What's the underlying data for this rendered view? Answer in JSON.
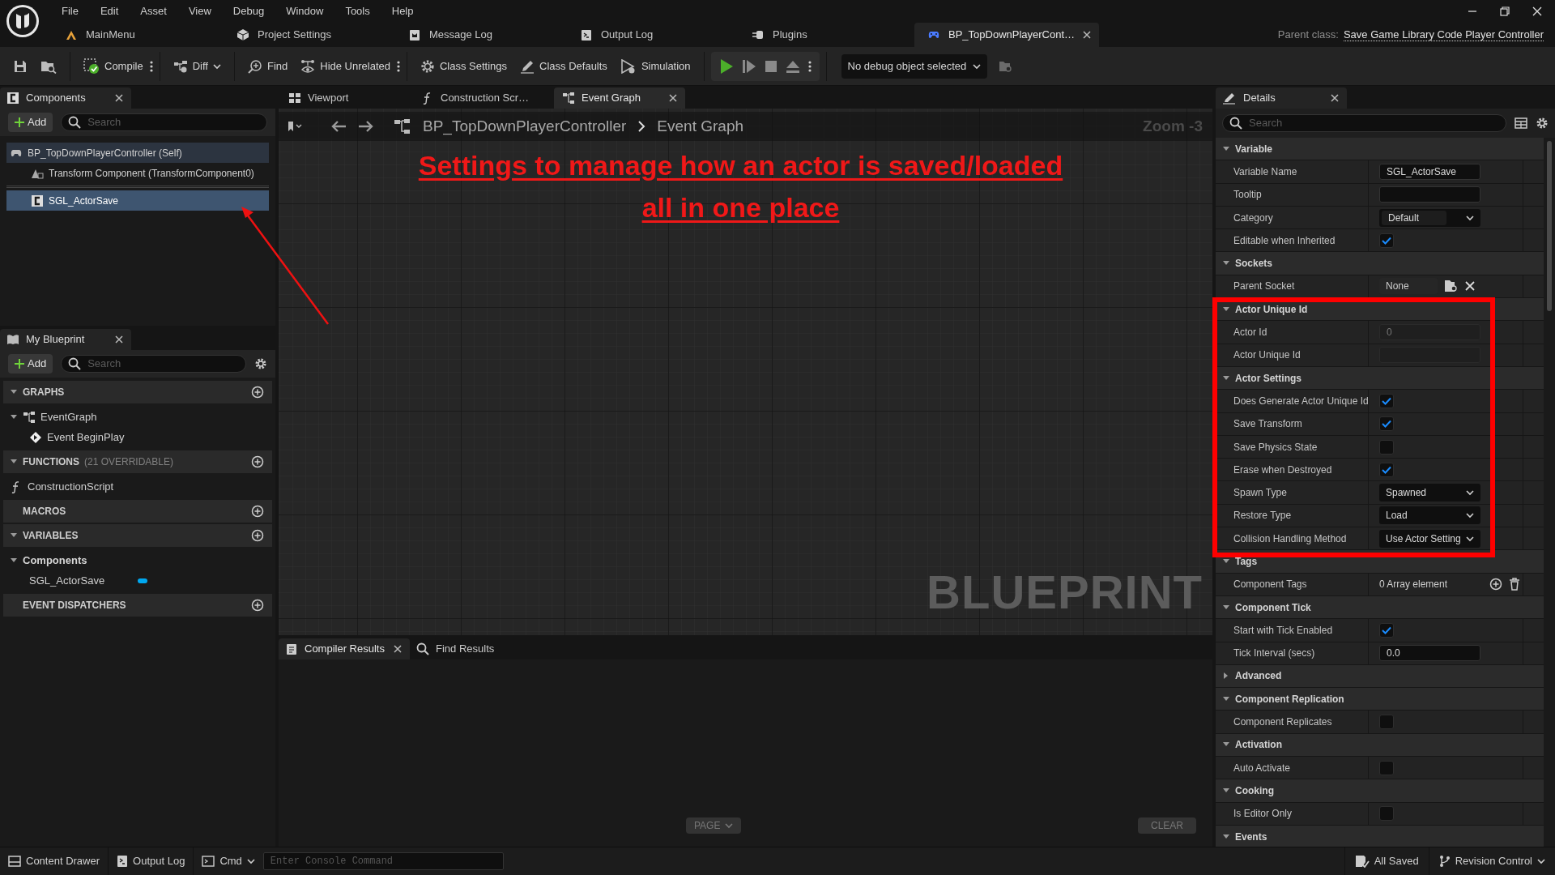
{
  "menu": [
    "File",
    "Edit",
    "Asset",
    "View",
    "Debug",
    "Window",
    "Tools",
    "Help"
  ],
  "asset_tabs": [
    {
      "label": "MainMenu",
      "selected": false
    },
    {
      "label": "Project Settings",
      "selected": false
    },
    {
      "label": "Message Log",
      "selected": false
    },
    {
      "label": "Output Log",
      "selected": false
    },
    {
      "label": "Plugins",
      "selected": false
    },
    {
      "label": "BP_TopDownPlayerCont…",
      "selected": true
    }
  ],
  "parent_class": {
    "label": "Parent class:",
    "value": "Save Game Library Code Player Controller"
  },
  "toolbar": {
    "compile": "Compile",
    "diff": "Diff",
    "find": "Find",
    "hide_unrelated": "Hide Unrelated",
    "class_settings": "Class Settings",
    "class_defaults": "Class Defaults",
    "simulation": "Simulation",
    "debug_object": "No debug object selected"
  },
  "components": {
    "title": "Components",
    "add": "Add",
    "search_placeholder": "Search",
    "items": [
      {
        "label": "BP_TopDownPlayerController (Self)",
        "selected": false,
        "children": [
          {
            "label": "Transform Component (TransformComponent0)",
            "kind": "native",
            "selected": false
          },
          {
            "label": "SGL_ActorSave",
            "kind": "added",
            "selected": true
          }
        ]
      }
    ]
  },
  "my_blueprint": {
    "title": "My Blueprint",
    "add": "Add",
    "search_placeholder": "Search",
    "sections": [
      {
        "title": "GRAPHS",
        "expanded": true,
        "items": [
          {
            "label": "EventGraph",
            "kind": "graph",
            "expanded": true,
            "children": [
              {
                "label": "Event BeginPlay",
                "kind": "event"
              }
            ]
          }
        ]
      },
      {
        "title": "FUNCTIONS",
        "note": "(21 OVERRIDABLE)",
        "expanded": true,
        "items": [
          {
            "label": "ConstructionScript",
            "kind": "function"
          }
        ]
      },
      {
        "title": "MACROS"
      },
      {
        "title": "VARIABLES",
        "expanded": true,
        "items": [
          {
            "label": "Components",
            "kind": "category",
            "expanded": true,
            "children": [
              {
                "label": "SGL_ActorSave",
                "kind": "variable",
                "color": "#00a8f0"
              }
            ]
          }
        ]
      },
      {
        "title": "EVENT DISPATCHERS"
      }
    ]
  },
  "graph": {
    "tabs": [
      {
        "label": "Viewport",
        "selected": false
      },
      {
        "label": "Construction Scr…",
        "selected": false
      },
      {
        "label": "Event Graph",
        "selected": true
      }
    ],
    "breadcrumb": [
      "BP_TopDownPlayerController",
      "Event Graph"
    ],
    "zoom": "Zoom -3",
    "watermark": "BLUEPRINT"
  },
  "annotation": {
    "lines": [
      "Settings to manage how an actor is saved/loaded",
      "all in one place"
    ]
  },
  "results": {
    "tabs": [
      {
        "label": "Compiler Results",
        "selected": true
      },
      {
        "label": "Find Results",
        "selected": false
      }
    ],
    "page": "PAGE",
    "clear": "CLEAR"
  },
  "details": {
    "title": "Details",
    "search_placeholder": "Search",
    "sections": [
      {
        "title": "Variable",
        "expanded": true,
        "rows": [
          {
            "label": "Variable Name",
            "kind": "text",
            "value": "SGL_ActorSave"
          },
          {
            "label": "Tooltip",
            "kind": "text"
          },
          {
            "label": "Category",
            "kind": "combo",
            "value": "Default"
          },
          {
            "label": "Editable when Inherited",
            "kind": "check",
            "checked": true
          }
        ]
      },
      {
        "title": "Sockets",
        "expanded": true,
        "rows": [
          {
            "label": "Parent Socket",
            "kind": "socket",
            "value": "None"
          }
        ]
      },
      {
        "title": "Actor Unique Id",
        "expanded": true,
        "rows": [
          {
            "label": "Actor Id",
            "kind": "text",
            "value": "0",
            "disabled": true
          },
          {
            "label": "Actor Unique Id",
            "kind": "text",
            "disabled": true
          }
        ]
      },
      {
        "title": "Actor Settings",
        "expanded": true,
        "rows": [
          {
            "label": "Does Generate Actor Unique Id",
            "kind": "check",
            "checked": true
          },
          {
            "label": "Save Transform",
            "kind": "check",
            "checked": true
          },
          {
            "label": "Save Physics State",
            "kind": "check",
            "checked": false
          },
          {
            "label": "Erase when Destroyed",
            "kind": "check",
            "checked": true
          },
          {
            "label": "Spawn Type",
            "kind": "dropdown",
            "value": "Spawned"
          },
          {
            "label": "Restore Type",
            "kind": "dropdown",
            "value": "Load"
          },
          {
            "label": "Collision Handling Method",
            "kind": "dropdown",
            "value": "Use Actor Setting"
          }
        ]
      },
      {
        "title": "Tags",
        "expanded": true,
        "rows": [
          {
            "label": "Component Tags",
            "kind": "array",
            "value": "0 Array element"
          }
        ]
      },
      {
        "title": "Component Tick",
        "expanded": true,
        "rows": [
          {
            "label": "Start with Tick Enabled",
            "kind": "check",
            "checked": true
          },
          {
            "label": "Tick Interval (secs)",
            "kind": "text",
            "value": "0.0"
          }
        ]
      },
      {
        "title": "Advanced",
        "expanded": false
      },
      {
        "title": "Component Replication",
        "expanded": true,
        "rows": [
          {
            "label": "Component Replicates",
            "kind": "check",
            "checked": false
          }
        ]
      },
      {
        "title": "Activation",
        "expanded": true,
        "rows": [
          {
            "label": "Auto Activate",
            "kind": "check",
            "checked": false
          }
        ]
      },
      {
        "title": "Cooking",
        "expanded": true,
        "rows": [
          {
            "label": "Is Editor Only",
            "kind": "check",
            "checked": false
          }
        ]
      },
      {
        "title": "Events",
        "expanded": true
      }
    ]
  },
  "status_bar": {
    "content_drawer": "Content Drawer",
    "output_log": "Output Log",
    "cmd": "Cmd",
    "console_placeholder": "Enter Console Command",
    "saved": "All Saved",
    "revision_control": "Revision Control"
  }
}
